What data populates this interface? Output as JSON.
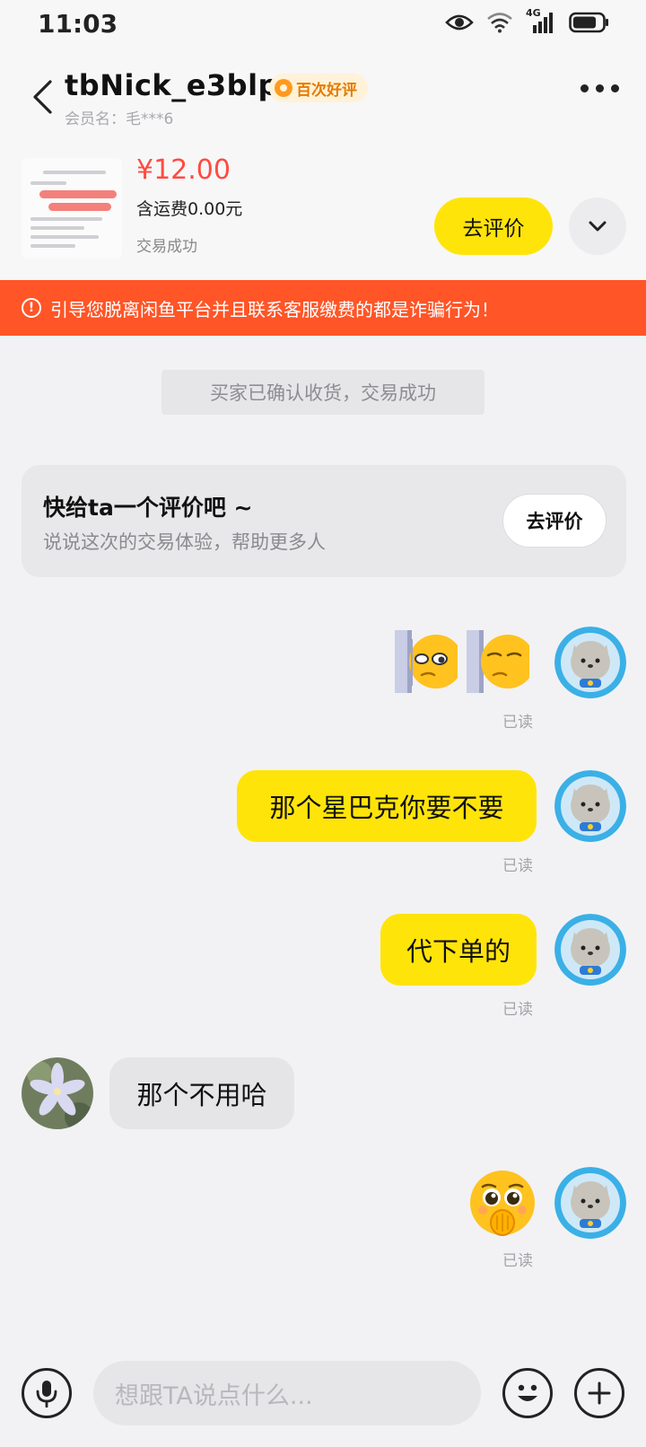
{
  "status_bar": {
    "time": "11:03",
    "network": "4G"
  },
  "header": {
    "nickname": "tbNick_e3blp",
    "badge": "百次好评",
    "member_label": "会员名：毛***6"
  },
  "product": {
    "price": "¥12.00",
    "shipping": "含运费0.00元",
    "status": "交易成功",
    "review_button": "去评价"
  },
  "warning": {
    "icon": "!",
    "text": "引导您脱离闲鱼平台并且联系客服缴费的都是诈骗行为！"
  },
  "chat": {
    "system_message": "买家已确认收货，交易成功",
    "review_card": {
      "title": "快给ta一个评价吧 ~",
      "subtitle": "说说这次的交易体验，帮助更多人",
      "button": "去评价"
    },
    "messages": [
      {
        "from": "me",
        "type": "sticker",
        "sticker": "peeking-emoji-sticker x2",
        "read": "已读"
      },
      {
        "from": "me",
        "type": "text",
        "text": "那个星巴克你要不要",
        "read": "已读"
      },
      {
        "from": "me",
        "type": "text",
        "text": "代下单的",
        "read": "已读"
      },
      {
        "from": "other",
        "type": "text",
        "text": "那个不用哈"
      },
      {
        "from": "me",
        "type": "sticker",
        "sticker": "pleading-emoji-sticker",
        "read": "已读"
      }
    ]
  },
  "input_bar": {
    "placeholder": "想跟TA说点什么..."
  },
  "colors": {
    "accent_yellow": "#ffe40a",
    "warning_orange": "#ff5527",
    "price_red": "#ff4b40",
    "badge_orange": "#e57a00"
  }
}
